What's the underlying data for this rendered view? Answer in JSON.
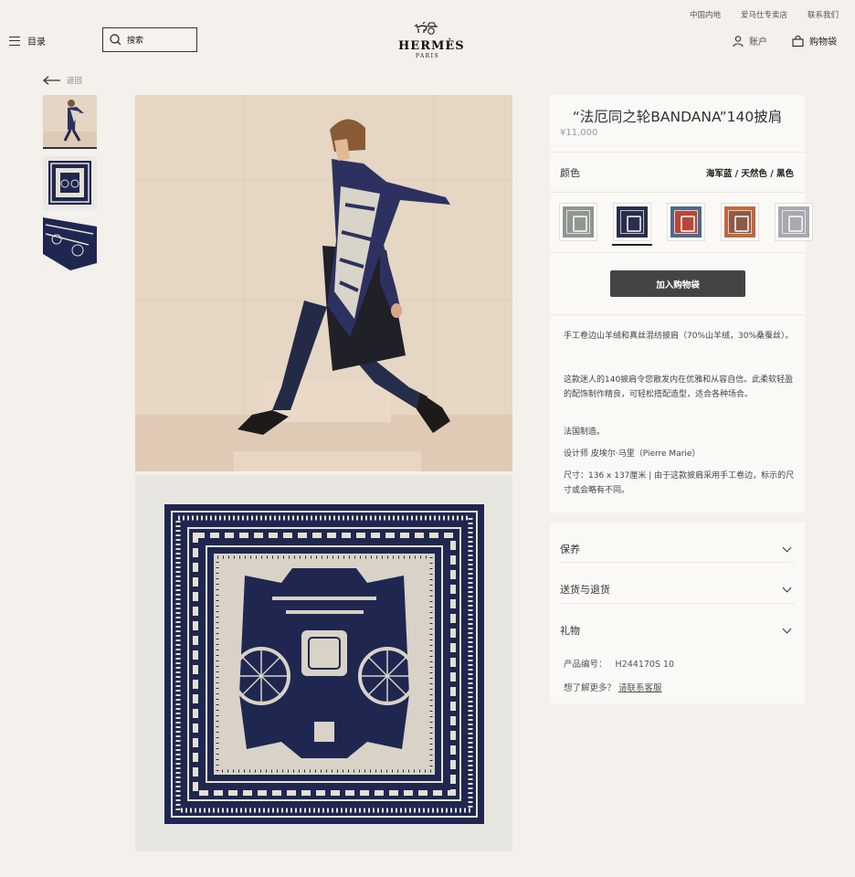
{
  "topbar": {
    "links": [
      "中国内地",
      "爱马仕专卖店",
      "联系我们"
    ]
  },
  "header": {
    "menu_label": "目录",
    "search_placeholder": "搜索",
    "logo_brand": "HERMÈS",
    "logo_city": "PARIS",
    "account_label": "账户",
    "bag_label": "购物袋"
  },
  "back_label": "返回",
  "product": {
    "title": "“法厄同之轮BANDANA”140披肩",
    "price": "¥11,000",
    "color_label": "颜色",
    "color_value": "海军蓝 / 天然色 / 黑色",
    "swatches": [
      {
        "name": "grey-green",
        "color": "#8f978e"
      },
      {
        "name": "navy",
        "color": "#2a2e4c"
      },
      {
        "name": "red-blue",
        "color": "#b8463a"
      },
      {
        "name": "brown-rust",
        "color": "#8d5a44"
      },
      {
        "name": "grey-white",
        "color": "#a7a9ae"
      }
    ],
    "selected_swatch": 1,
    "add_to_bag": "加入购物袋",
    "description": [
      "手工卷边山羊绒和真丝混纺披肩（70%山羊绒，30%桑蚕丝）。",
      "这款迷人的140披肩令您散发内在优雅和从容自信。此柔软轻盈的配饰制作精良，可轻松搭配造型，适合各种场合。",
      "法国制造。",
      "设计师 皮埃尔·马里（Pierre Marie）",
      "尺寸：136 x 137厘米 | 由于这款披肩采用手工卷边，标示的尺寸或会略有不同。"
    ]
  },
  "accordion": {
    "care": "保养",
    "shipping": "送货与退货",
    "gift": "礼物"
  },
  "meta": {
    "product_code_label": "产品编号：",
    "product_code": "H244170S 10",
    "more_label": "想了解更多？",
    "contact_link": "请联系客服"
  },
  "colors": {
    "background": "#f4f0eb",
    "panel": "#fbf9f6",
    "button": "#444444",
    "scarf_navy": "#1f2751"
  }
}
